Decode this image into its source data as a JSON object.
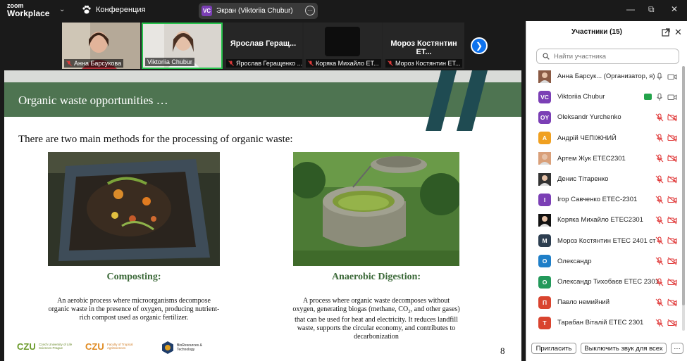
{
  "app": {
    "logo_line1": "zoom",
    "logo_line2": "Workplace",
    "conference_label": "Конференция"
  },
  "screen_share": {
    "badge": "VC",
    "label": "Экран (Viktoriia Chubur)"
  },
  "video_strip": {
    "tiles": [
      {
        "name": "Анна Барсукова",
        "muted": true
      },
      {
        "name": "Viktoriia Chubur",
        "muted": false,
        "active": true
      },
      {
        "name": "Ярослав Геращенко ...",
        "big_name": "Ярослав Геращ...",
        "muted": true
      },
      {
        "name": "Коряка Михайло ЕТ...",
        "muted": true
      },
      {
        "name": "Мороз Костянтин ЕТ...",
        "big_name": "Мороз Костянтин ЕТ...",
        "muted": true
      }
    ]
  },
  "slide": {
    "title": "Organic waste opportunities …",
    "subtitle": "There are two main methods for the processing of organic waste:",
    "left_heading": "Composting:",
    "left_text": "An aerobic process where microorganisms decompose organic waste in the presence of oxygen, producing nutrient-rich compost used as organic fertilizer.",
    "right_heading": "Anaerobic Digestion:",
    "right_text_a": "A process where organic waste decomposes without oxygen, generating biogas (methane, CO",
    "right_text_sub": "2",
    "right_text_b": ", and other gases) that can be used for heat and electricity. It reduces landfill waste, supports the circular economy, and contributes to decarbonization",
    "page_number": "8",
    "logo1_text": "Czech University of Life Sciences Prague",
    "logo2_text": "Faculty of Tropical AgriSciences",
    "logo3_text": "BioResources & Technology"
  },
  "panel": {
    "title": "Участники (15)",
    "search_placeholder": "Найти участника",
    "participants": [
      {
        "name": "Анна Барсук... (Организатор, я)",
        "initials": "",
        "color": "#8a5a44",
        "photo": true,
        "mic": "on-gray",
        "cam": "on-gray"
      },
      {
        "name": "Viktoriia Chubur",
        "initials": "VC",
        "color": "#7b3fb5",
        "mic": "on-gray",
        "cam": "on-gray",
        "sharing": true
      },
      {
        "name": "Oleksandr Yurchenko",
        "initials": "OY",
        "color": "#7b3fb5",
        "mic": "off",
        "cam": "off"
      },
      {
        "name": "Андрій ЧЕПІЖНИЙ",
        "initials": "А",
        "color": "#f0a020",
        "mic": "off",
        "cam": "off"
      },
      {
        "name": "Артем Жук ЕТЕС2301",
        "initials": "",
        "color": "#d9a07a",
        "photo": true,
        "mic": "off",
        "cam": "off"
      },
      {
        "name": "Денис Тітаренко",
        "initials": "",
        "color": "#333333",
        "photo": true,
        "mic": "off",
        "cam": "off"
      },
      {
        "name": "Ігор Савченко ЕТЕС-2301",
        "initials": "І",
        "color": "#7b3fb5",
        "mic": "off",
        "cam": "off"
      },
      {
        "name": "Коряка Михайло ЕТЕС2301",
        "initials": "",
        "color": "#111111",
        "photo": true,
        "mic": "off",
        "cam": "off"
      },
      {
        "name": "Мороз Костянтин ЕТЕС 2401 ст",
        "initials": "М",
        "color": "#2d3e50",
        "mic": "off",
        "cam": "off"
      },
      {
        "name": "Олександр",
        "initials": "О",
        "color": "#1f7fc8",
        "mic": "off",
        "cam": "off"
      },
      {
        "name": "Олександр Тихобаєв ЕТЕС 2301",
        "initials": "О",
        "color": "#23995a",
        "mic": "off",
        "cam": "off"
      },
      {
        "name": "Павло немийний",
        "initials": "П",
        "color": "#d9442f",
        "mic": "off",
        "cam": "off"
      },
      {
        "name": "Тарабан Віталій ЕТЕС 2301",
        "initials": "Т",
        "color": "#d9442f",
        "mic": "off",
        "cam": "off"
      }
    ],
    "invite_label": "Пригласить",
    "mute_all_label": "Выключить звук для всех",
    "more_label": "···"
  }
}
